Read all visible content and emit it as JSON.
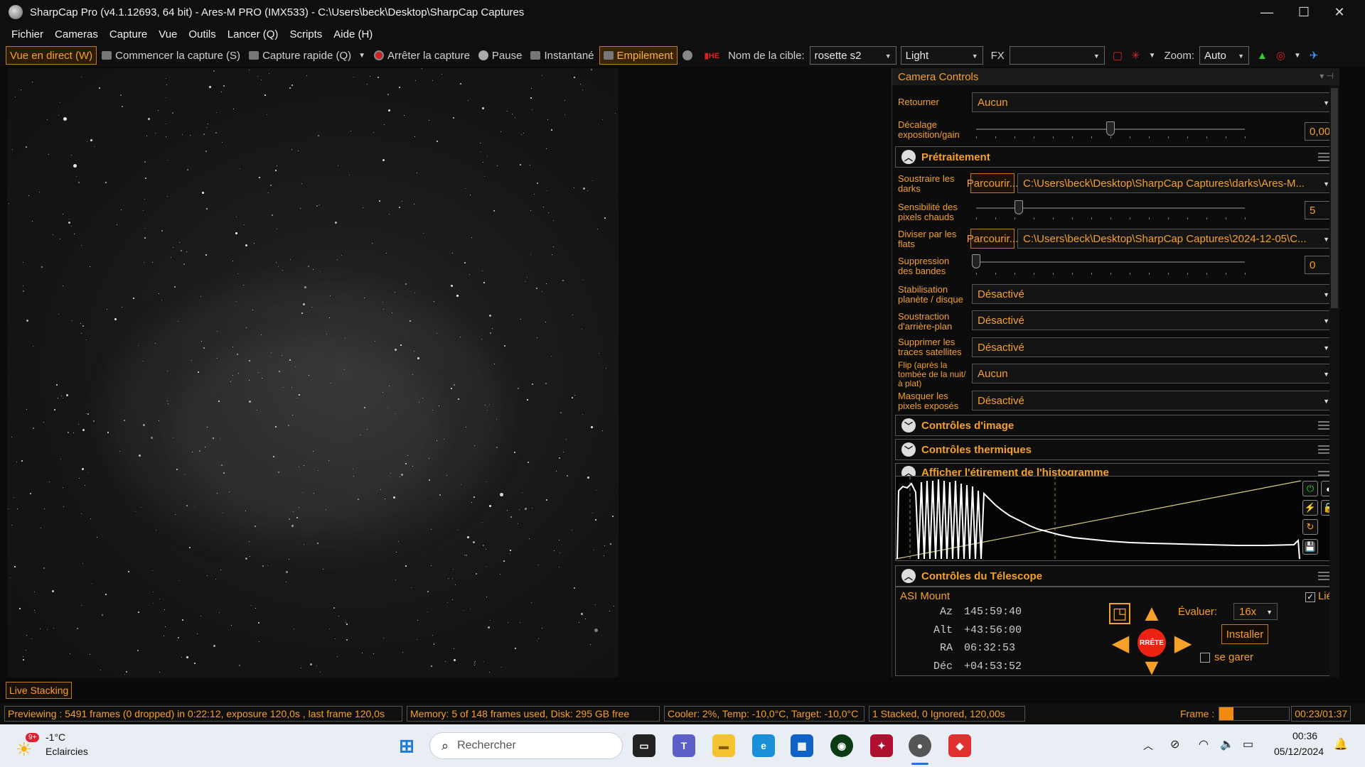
{
  "window": {
    "title": "SharpCap Pro (v4.1.12693, 64 bit) - Ares-M PRO (IMX533) - C:\\Users\\beck\\Desktop\\SharpCap Captures",
    "minimize": "—",
    "maximize": "☐",
    "close": "✕"
  },
  "menu": [
    "Fichier",
    "Cameras",
    "Capture",
    "Vue",
    "Outils",
    "Lancer (Q)",
    "Scripts",
    "Aide (H)"
  ],
  "toolbar": {
    "live_view": "Vue en direct (W)",
    "start_capture": "Commencer la capture (S)",
    "quick_capture": "Capture rapide (Q)",
    "stop_capture": "Arrêter la capture",
    "pause": "Pause",
    "snapshot": "Instantané",
    "stacking": "Empilement",
    "target_label": "Nom de la cible:",
    "target_value": "rosette s2",
    "frame_type": "Light",
    "fx_label": "FX",
    "fx_value": "",
    "zoom_label": "Zoom:",
    "zoom_value": "Auto"
  },
  "panel": {
    "title": "Camera Controls",
    "flip_label": "Retourner",
    "flip_value": "Aucun",
    "offset_label": "Décalage exposition/gain",
    "offset_value": "0,00",
    "offset_level": 0.5,
    "preprocessing": {
      "title": "Prétraitement",
      "darks_label": "Soustraire les darks",
      "browse": "Parcourir...",
      "darks_path": "C:\\Users\\beck\\Desktop\\SharpCap Captures\\darks\\Ares-M...",
      "hotpixel_label": "Sensibilité des pixels chauds",
      "hotpixel_value": "5",
      "hotpixel_level": 0.16,
      "flats_label": "Diviser par les flats",
      "flats_path": "C:\\Users\\beck\\Desktop\\SharpCap Captures\\2024-12-05\\C...",
      "banding_label": "Suppression des bandes",
      "banding_value": "0",
      "banding_level": 0,
      "stab_label": "Stabilisation planète / disque",
      "stab_value": "Désactivé",
      "bg_label": "Soustraction d'arrière-plan",
      "bg_value": "Désactivé",
      "sat_label": "Supprimer les traces satellites",
      "sat_value": "Désactivé",
      "flip2_label": "Flip (après la tombée de la nuit/à plat)",
      "flip2_value": "Aucun",
      "mask_label": "Masquer les pixels exposés",
      "mask_value": "Désactivé"
    },
    "image_controls": "Contrôles d'image",
    "thermal_controls": "Contrôles thermiques",
    "histogram": "Afficher l'étirement de l'histogramme",
    "telescope": {
      "title": "Contrôles du Télescope",
      "mount": "ASI Mount",
      "linked": "Lié",
      "az_label": "Az",
      "az": "145:59:40",
      "alt_label": "Alt",
      "alt": "+43:56:00",
      "ra_label": "RA",
      "ra": "06:32:53",
      "dec_label": "Déc",
      "dec": "+04:53:52",
      "rate_label": "Évaluer:",
      "rate_value": "16x",
      "install": "Installer",
      "park": "se garer",
      "stop": "RRÊTE"
    }
  },
  "bottom_tab": "Live Stacking",
  "status": {
    "preview": "Previewing : 5491 frames (0 dropped) in 0:22:12, exposure 120,0s , last frame 120,0s",
    "memory": "Memory: 5 of 148 frames used, Disk: 295 GB free",
    "cooler": "Cooler: 2%, Temp: -10,0°C, Target: -10,0°C",
    "stacked": "1 Stacked, 0 Ignored, 120,00s",
    "frame_label": "Frame :",
    "time": "00:23/01:37"
  },
  "taskbar": {
    "weather_temp": "-1°C",
    "weather_desc": "Eclaircies",
    "weather_badge": "9+",
    "search": "Rechercher",
    "clock_time": "00:36",
    "clock_date": "05/12/2024"
  }
}
